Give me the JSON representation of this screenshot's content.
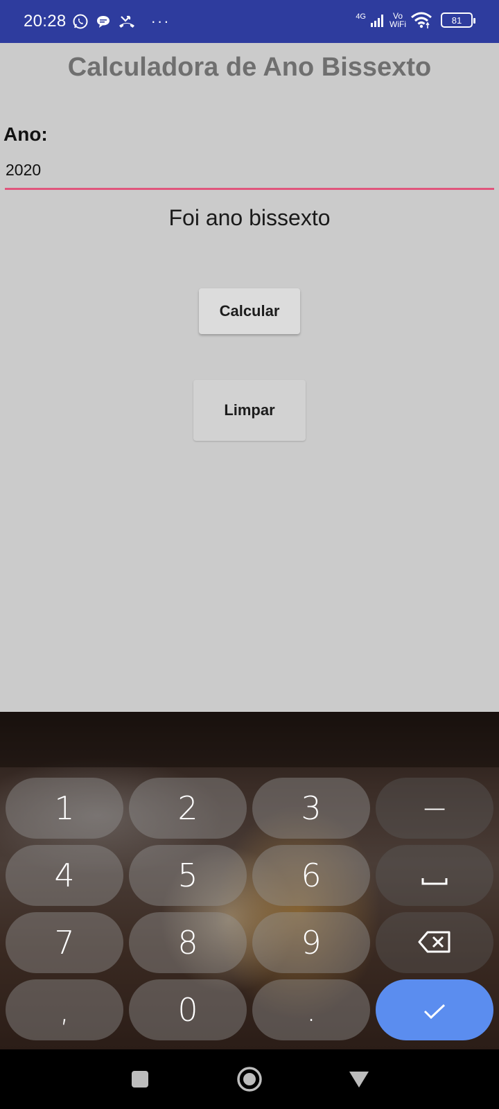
{
  "status_bar": {
    "time": "20:28",
    "left_icons": [
      "whatsapp-icon",
      "chat-bubble-icon",
      "missed-call-icon"
    ],
    "more_indicator": "···",
    "network_label": "4G",
    "volte_top": "Vo",
    "volte_bottom": "WiFi",
    "battery_level": "81",
    "background_color": "#2e3c9e"
  },
  "app": {
    "title": "Calculadora de Ano Bissexto",
    "year_label": "Ano:",
    "year_value": "2020",
    "result": "Foi ano bissexto",
    "calculate_button": "Calcular",
    "clear_button": "Limpar",
    "background_color": "#cbcbcb",
    "input_underline_color": "#e0557c"
  },
  "keyboard": {
    "rows": [
      [
        "1",
        "2",
        "3",
        "−"
      ],
      [
        "4",
        "5",
        "6",
        "␣"
      ],
      [
        "7",
        "8",
        "9",
        "⌫"
      ],
      [
        ",",
        "0",
        ".",
        "✓"
      ]
    ],
    "enter_color": "#5b8def"
  },
  "nav_bar": {
    "buttons": [
      "recents-square-icon",
      "home-circle-icon",
      "back-triangle-icon"
    ]
  }
}
